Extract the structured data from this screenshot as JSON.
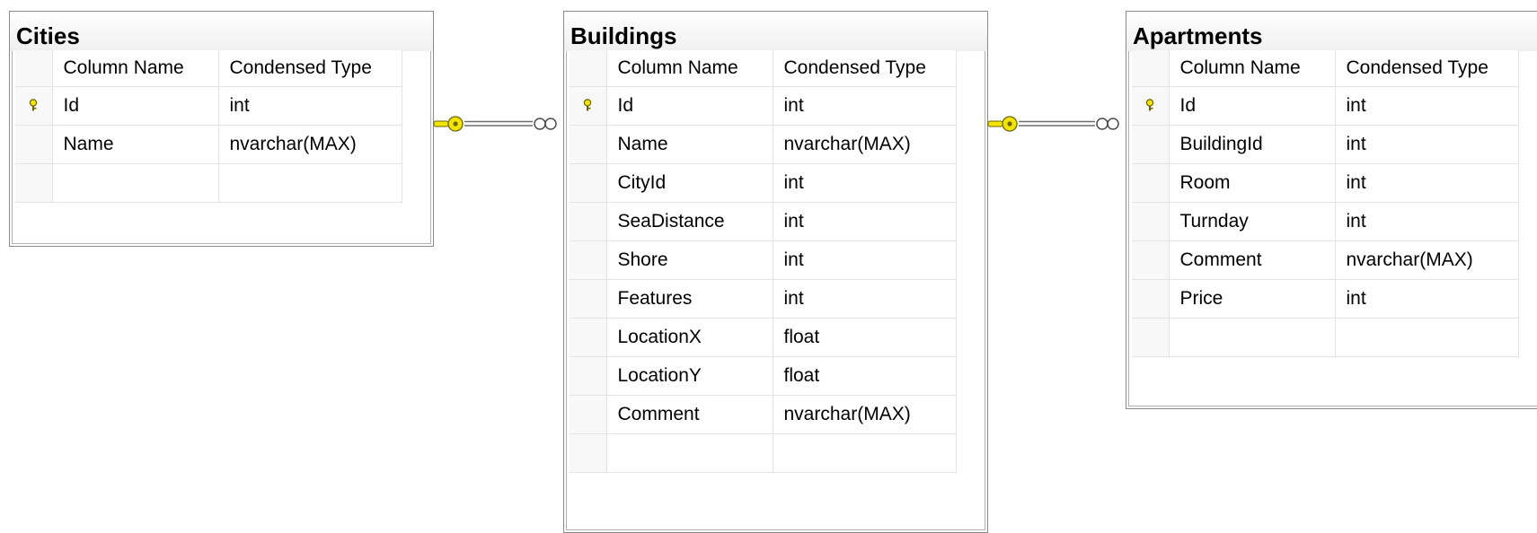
{
  "headers": {
    "column_name": "Column Name",
    "condensed_type": "Condensed Type"
  },
  "tables": {
    "cities": {
      "title": "Cities",
      "rows": [
        {
          "name": "Id",
          "type": "int",
          "pk": true
        },
        {
          "name": "Name",
          "type": "nvarchar(MAX)",
          "pk": false
        }
      ]
    },
    "buildings": {
      "title": "Buildings",
      "rows": [
        {
          "name": "Id",
          "type": "int",
          "pk": true
        },
        {
          "name": "Name",
          "type": "nvarchar(MAX)",
          "pk": false
        },
        {
          "name": "CityId",
          "type": "int",
          "pk": false
        },
        {
          "name": "SeaDistance",
          "type": "int",
          "pk": false
        },
        {
          "name": "Shore",
          "type": "int",
          "pk": false
        },
        {
          "name": "Features",
          "type": "int",
          "pk": false
        },
        {
          "name": "LocationX",
          "type": "float",
          "pk": false
        },
        {
          "name": "LocationY",
          "type": "float",
          "pk": false
        },
        {
          "name": "Comment",
          "type": "nvarchar(MAX)",
          "pk": false
        }
      ]
    },
    "apartments": {
      "title": "Apartments",
      "rows": [
        {
          "name": "Id",
          "type": "int",
          "pk": true
        },
        {
          "name": "BuildingId",
          "type": "int",
          "pk": false
        },
        {
          "name": "Room",
          "type": "int",
          "pk": false
        },
        {
          "name": "Turnday",
          "type": "int",
          "pk": false
        },
        {
          "name": "Comment",
          "type": "nvarchar(MAX)",
          "pk": false
        },
        {
          "name": "Price",
          "type": "int",
          "pk": false
        }
      ]
    }
  },
  "relationships": [
    {
      "from": "Cities",
      "to": "Buildings",
      "one_end": "key-icon",
      "many_end": "infinity-icon"
    },
    {
      "from": "Buildings",
      "to": "Apartments",
      "one_end": "key-icon",
      "many_end": "infinity-icon"
    }
  ],
  "colors": {
    "key_yellow": "#f2e600",
    "key_outline": "#6b6400",
    "border": "#8a8a8a",
    "grid_line": "#e3e3e3"
  }
}
